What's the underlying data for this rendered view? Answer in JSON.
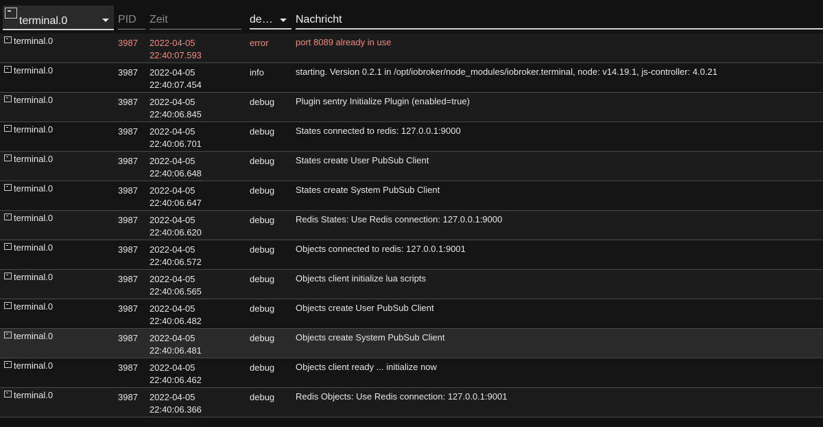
{
  "header": {
    "source_filter": "terminal.0",
    "pid_label": "PID",
    "time_label": "Zeit",
    "severity_filter": "de…",
    "message_label": "Nachricht"
  },
  "logs": [
    {
      "source": "terminal.0",
      "pid": "3987",
      "date": "2022-04-05",
      "time": "22:40:07.593",
      "severity": "error",
      "message": "port 8089 already in use"
    },
    {
      "source": "terminal.0",
      "pid": "3987",
      "date": "2022-04-05",
      "time": "22:40:07.454",
      "severity": "info",
      "message": "starting. Version 0.2.1 in /opt/iobroker/node_modules/iobroker.terminal, node: v14.19.1, js-controller: 4.0.21"
    },
    {
      "source": "terminal.0",
      "pid": "3987",
      "date": "2022-04-05",
      "time": "22:40:06.845",
      "severity": "debug",
      "message": "Plugin sentry Initialize Plugin (enabled=true)"
    },
    {
      "source": "terminal.0",
      "pid": "3987",
      "date": "2022-04-05",
      "time": "22:40:06.701",
      "severity": "debug",
      "message": "States connected to redis: 127.0.0.1:9000"
    },
    {
      "source": "terminal.0",
      "pid": "3987",
      "date": "2022-04-05",
      "time": "22:40:06.648",
      "severity": "debug",
      "message": "States create User PubSub Client"
    },
    {
      "source": "terminal.0",
      "pid": "3987",
      "date": "2022-04-05",
      "time": "22:40:06.647",
      "severity": "debug",
      "message": "States create System PubSub Client"
    },
    {
      "source": "terminal.0",
      "pid": "3987",
      "date": "2022-04-05",
      "time": "22:40:06.620",
      "severity": "debug",
      "message": "Redis States: Use Redis connection: 127.0.0.1:9000"
    },
    {
      "source": "terminal.0",
      "pid": "3987",
      "date": "2022-04-05",
      "time": "22:40:06.572",
      "severity": "debug",
      "message": "Objects connected to redis: 127.0.0.1:9001"
    },
    {
      "source": "terminal.0",
      "pid": "3987",
      "date": "2022-04-05",
      "time": "22:40:06.565",
      "severity": "debug",
      "message": "Objects client initialize lua scripts"
    },
    {
      "source": "terminal.0",
      "pid": "3987",
      "date": "2022-04-05",
      "time": "22:40:06.482",
      "severity": "debug",
      "message": "Objects create User PubSub Client"
    },
    {
      "source": "terminal.0",
      "pid": "3987",
      "date": "2022-04-05",
      "time": "22:40:06.481",
      "severity": "debug",
      "message": "Objects create System PubSub Client"
    },
    {
      "source": "terminal.0",
      "pid": "3987",
      "date": "2022-04-05",
      "time": "22:40:06.462",
      "severity": "debug",
      "message": "Objects client ready ... initialize now"
    },
    {
      "source": "terminal.0",
      "pid": "3987",
      "date": "2022-04-05",
      "time": "22:40:06.366",
      "severity": "debug",
      "message": "Redis Objects: Use Redis connection: 127.0.0.1:9001"
    }
  ]
}
